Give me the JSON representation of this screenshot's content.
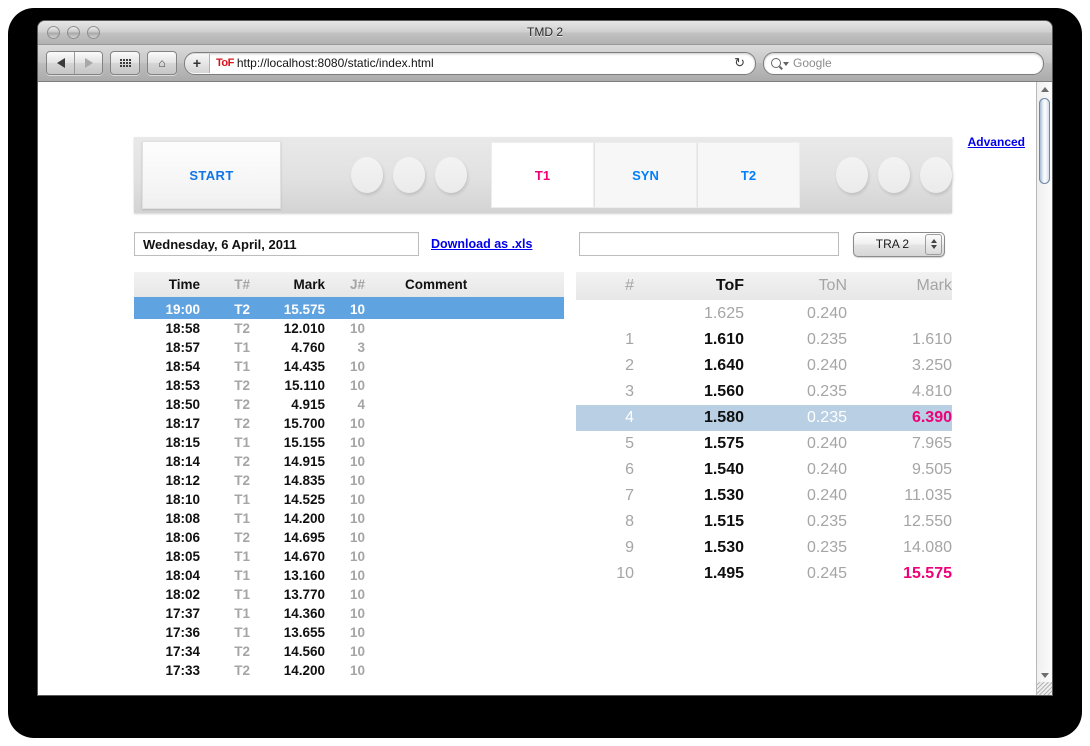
{
  "window": {
    "title": "TMD 2"
  },
  "browser": {
    "back_icon": "back-arrow-icon",
    "forward_icon": "forward-arrow-icon",
    "grid_icon": "grid-view-icon",
    "home_icon": "home-icon",
    "add_label": "+",
    "favicon_text": "ToF",
    "url": "http://localhost:8080/static/index.html",
    "reload_icon": "↻",
    "search_placeholder": "Google",
    "search_value": ""
  },
  "app": {
    "advanced_link": "Advanced",
    "start_label": "START",
    "tabs": [
      {
        "label": "T1",
        "color": "#ee0078",
        "active": true
      },
      {
        "label": "SYN",
        "color": "#0080ff",
        "active": false
      },
      {
        "label": "T2",
        "color": "#0080ff",
        "active": false
      }
    ],
    "left_dots": 3,
    "right_dots": 3,
    "date_value": "Wednesday, 6 April, 2011",
    "download_label": "Download as .xls",
    "session_value": "",
    "session_placeholder": "",
    "track_select": "TRA 2"
  },
  "left_table": {
    "headers": [
      "Time",
      "T#",
      "Mark",
      "J#",
      "Comment"
    ],
    "rows": [
      {
        "time": "19:00",
        "t": "T2",
        "mark": "15.575",
        "j": "10",
        "comment": "",
        "selected": true
      },
      {
        "time": "18:58",
        "t": "T2",
        "mark": "12.010",
        "j": "10",
        "comment": "",
        "selected": false
      },
      {
        "time": "18:57",
        "t": "T1",
        "mark": "4.760",
        "j": "3",
        "comment": "",
        "selected": false
      },
      {
        "time": "18:54",
        "t": "T1",
        "mark": "14.435",
        "j": "10",
        "comment": "",
        "selected": false
      },
      {
        "time": "18:53",
        "t": "T2",
        "mark": "15.110",
        "j": "10",
        "comment": "",
        "selected": false
      },
      {
        "time": "18:50",
        "t": "T2",
        "mark": "4.915",
        "j": "4",
        "comment": "",
        "selected": false
      },
      {
        "time": "18:17",
        "t": "T2",
        "mark": "15.700",
        "j": "10",
        "comment": "",
        "selected": false
      },
      {
        "time": "18:15",
        "t": "T1",
        "mark": "15.155",
        "j": "10",
        "comment": "",
        "selected": false
      },
      {
        "time": "18:14",
        "t": "T2",
        "mark": "14.915",
        "j": "10",
        "comment": "",
        "selected": false
      },
      {
        "time": "18:12",
        "t": "T2",
        "mark": "14.835",
        "j": "10",
        "comment": "",
        "selected": false
      },
      {
        "time": "18:10",
        "t": "T1",
        "mark": "14.525",
        "j": "10",
        "comment": "",
        "selected": false
      },
      {
        "time": "18:08",
        "t": "T1",
        "mark": "14.200",
        "j": "10",
        "comment": "",
        "selected": false
      },
      {
        "time": "18:06",
        "t": "T2",
        "mark": "14.695",
        "j": "10",
        "comment": "",
        "selected": false
      },
      {
        "time": "18:05",
        "t": "T1",
        "mark": "14.670",
        "j": "10",
        "comment": "",
        "selected": false
      },
      {
        "time": "18:04",
        "t": "T1",
        "mark": "13.160",
        "j": "10",
        "comment": "",
        "selected": false
      },
      {
        "time": "18:02",
        "t": "T1",
        "mark": "13.770",
        "j": "10",
        "comment": "",
        "selected": false
      },
      {
        "time": "17:37",
        "t": "T1",
        "mark": "14.360",
        "j": "10",
        "comment": "",
        "selected": false
      },
      {
        "time": "17:36",
        "t": "T1",
        "mark": "13.655",
        "j": "10",
        "comment": "",
        "selected": false
      },
      {
        "time": "17:34",
        "t": "T2",
        "mark": "14.560",
        "j": "10",
        "comment": "",
        "selected": false
      },
      {
        "time": "17:33",
        "t": "T2",
        "mark": "14.200",
        "j": "10",
        "comment": "",
        "selected": false
      }
    ]
  },
  "right_table": {
    "headers": [
      "#",
      "ToF",
      "ToN",
      "Mark"
    ],
    "rows": [
      {
        "num": "",
        "tof": "1.625",
        "ton": "0.240",
        "mark": "",
        "selected": false,
        "pink": false,
        "dim_tof": true
      },
      {
        "num": "1",
        "tof": "1.610",
        "ton": "0.235",
        "mark": "1.610",
        "selected": false,
        "pink": false,
        "dim_tof": false
      },
      {
        "num": "2",
        "tof": "1.640",
        "ton": "0.240",
        "mark": "3.250",
        "selected": false,
        "pink": false,
        "dim_tof": false
      },
      {
        "num": "3",
        "tof": "1.560",
        "ton": "0.235",
        "mark": "4.810",
        "selected": false,
        "pink": false,
        "dim_tof": false
      },
      {
        "num": "4",
        "tof": "1.580",
        "ton": "0.235",
        "mark": "6.390",
        "selected": true,
        "pink": true,
        "dim_tof": false
      },
      {
        "num": "5",
        "tof": "1.575",
        "ton": "0.240",
        "mark": "7.965",
        "selected": false,
        "pink": false,
        "dim_tof": false
      },
      {
        "num": "6",
        "tof": "1.540",
        "ton": "0.240",
        "mark": "9.505",
        "selected": false,
        "pink": false,
        "dim_tof": false
      },
      {
        "num": "7",
        "tof": "1.530",
        "ton": "0.240",
        "mark": "11.035",
        "selected": false,
        "pink": false,
        "dim_tof": false
      },
      {
        "num": "8",
        "tof": "1.515",
        "ton": "0.235",
        "mark": "12.550",
        "selected": false,
        "pink": false,
        "dim_tof": false
      },
      {
        "num": "9",
        "tof": "1.530",
        "ton": "0.235",
        "mark": "14.080",
        "selected": false,
        "pink": false,
        "dim_tof": false
      },
      {
        "num": "10",
        "tof": "1.495",
        "ton": "0.245",
        "mark": "15.575",
        "selected": false,
        "pink": true,
        "dim_tof": false
      }
    ]
  },
  "colors": {
    "selection_blue": "#5fa3e0",
    "selection_light_blue": "#b9cfe4",
    "accent_pink": "#ee0078",
    "accent_blue": "#0080ff",
    "link_blue": "#0000ee"
  }
}
